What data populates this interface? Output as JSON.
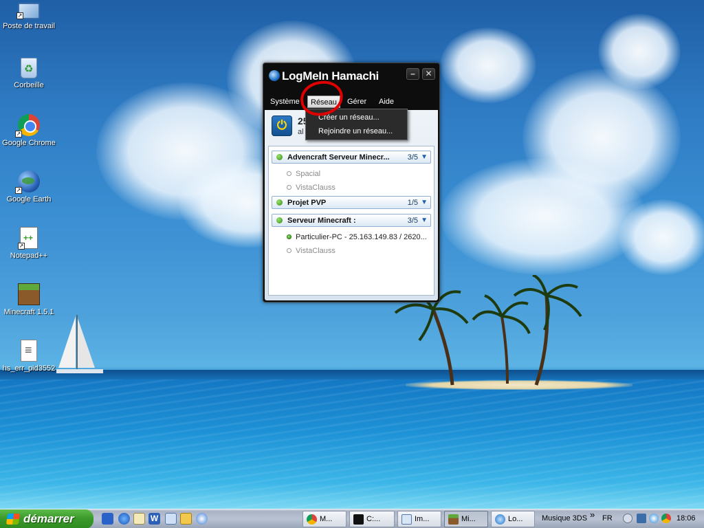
{
  "desktop": {
    "icons": [
      {
        "label": "Poste de travail",
        "icon": "computer-icon"
      },
      {
        "label": "Corbeille",
        "icon": "recycle-bin-icon"
      },
      {
        "label": "Google Chrome",
        "icon": "chrome-icon"
      },
      {
        "label": "Google Earth",
        "icon": "google-earth-icon"
      },
      {
        "label": "Notepad++",
        "icon": "notepad-plus-plus-icon"
      },
      {
        "label": "Minecraft 1.5.1",
        "icon": "minecraft-icon"
      },
      {
        "label": "hs_err_pid3552",
        "icon": "text-file-icon"
      }
    ]
  },
  "hamachi": {
    "title": "LogMeIn Hamachi",
    "minimize": "–",
    "close": "✕",
    "menus": [
      "Système",
      "Réseau",
      "Gérer",
      "Aide"
    ],
    "active_menu": "Réseau",
    "dropdown": [
      "Créer un réseau...",
      "Rejoindre un réseau..."
    ],
    "power_symbol": "⏻",
    "id_partial": "25",
    "sub_partial": "al",
    "networks": [
      {
        "name": "Advencraft Serveur Minecr...",
        "count": "3/5",
        "peers": [
          {
            "name": "Spacial",
            "online": false
          },
          {
            "name": "VistaClauss",
            "online": false
          }
        ]
      },
      {
        "name": "Projet PVP",
        "count": "1/5",
        "peers": []
      },
      {
        "name": "Serveur Minecraft :",
        "count": "3/5",
        "peers": [
          {
            "name": "Particulier-PC - 25.163.149.83 / 2620...",
            "online": true
          },
          {
            "name": "VistaClauss",
            "online": false
          }
        ]
      }
    ]
  },
  "taskbar": {
    "start_label": "démarrer",
    "tasks": [
      {
        "label": "M...",
        "icon": "chrome-icon",
        "active": false
      },
      {
        "label": "C:...",
        "icon": "cmd-icon",
        "active": false
      },
      {
        "label": "Im...",
        "icon": "image-icon",
        "active": false
      },
      {
        "label": "Mi...",
        "icon": "minecraft-icon",
        "active": true
      },
      {
        "label": "Lo...",
        "icon": "hamachi-icon",
        "active": false
      }
    ],
    "toolbar_label": "Musique 3DS",
    "chevron": "»",
    "language": "FR",
    "clock": "18:06"
  },
  "colors": {
    "accent_red": "#e00000",
    "online_green": "#2f8a16",
    "start_green": "#3b9a2b"
  }
}
